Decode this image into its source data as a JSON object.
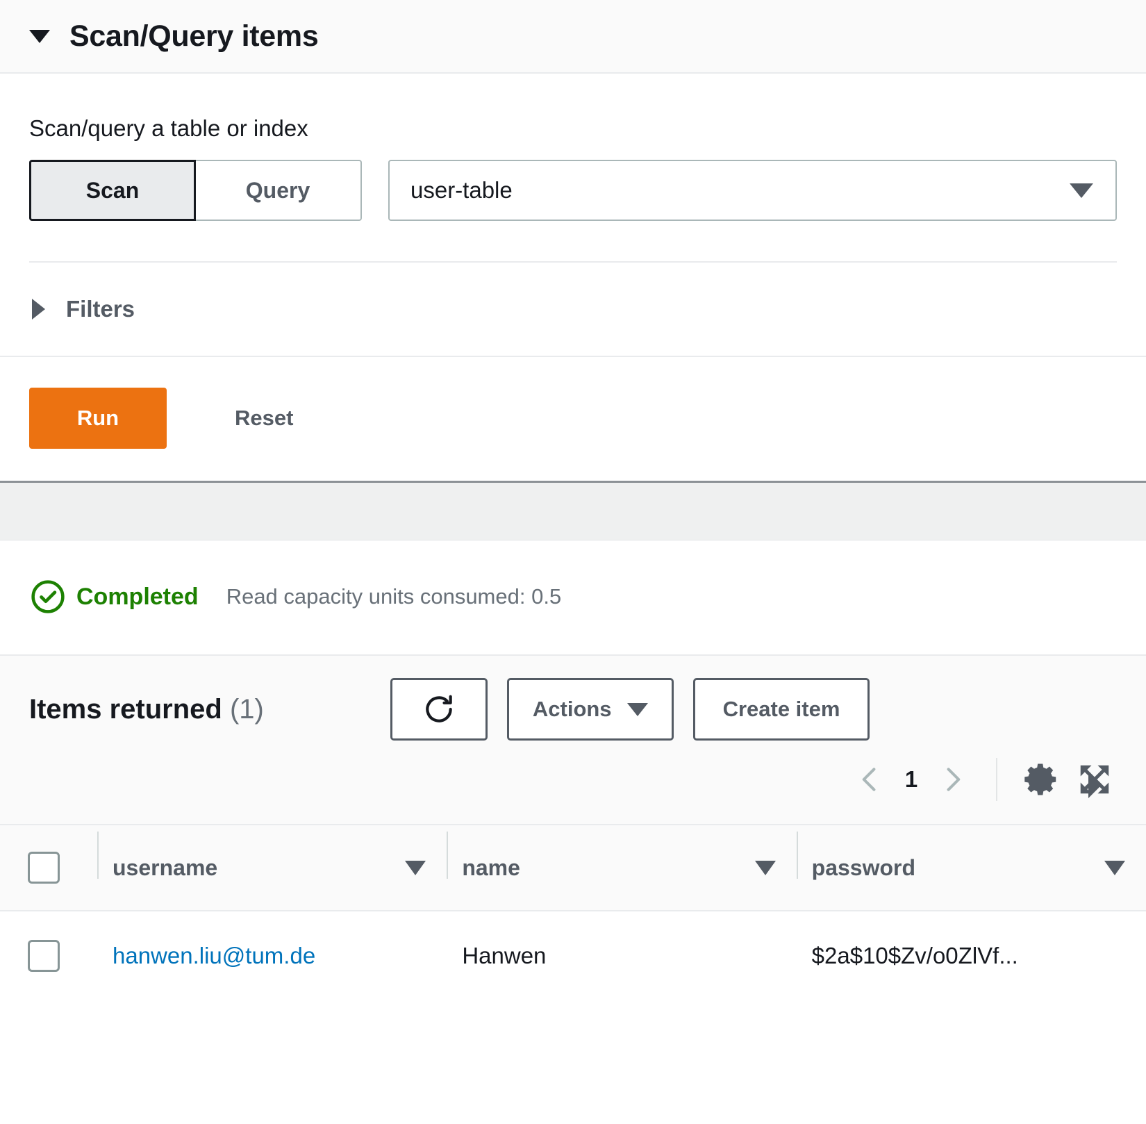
{
  "section": {
    "title": "Scan/Query items",
    "collapse_icon": "caret-down-icon"
  },
  "scan_query": {
    "field_label": "Scan/query a table or index",
    "mode_options": [
      "Scan",
      "Query"
    ],
    "selected_mode": "Scan",
    "scan_label": "Scan",
    "query_label": "Query",
    "table_select_value": "user-table",
    "table_select_options": [
      "user-table"
    ]
  },
  "filters": {
    "label": "Filters",
    "expanded": false
  },
  "buttons": {
    "run": "Run",
    "reset": "Reset",
    "run_color": "#ec7211"
  },
  "status": {
    "state": "Completed",
    "state_color": "#1d8102",
    "detail": "Read capacity units consumed: 0.5"
  },
  "items": {
    "title": "Items returned",
    "count": "(1)",
    "refresh_label": "",
    "actions_label": "Actions",
    "create_item_label": "Create item"
  },
  "pagination": {
    "prev_label": "",
    "page": "1",
    "next_label": "",
    "settings_label": "",
    "fullscreen_label": ""
  },
  "table": {
    "columns": [
      {
        "label": "username"
      },
      {
        "label": "name"
      },
      {
        "label": "password"
      }
    ],
    "rows": [
      {
        "username": "hanwen.liu@tum.de",
        "name": "Hanwen",
        "password": "$2a$10$Zv/o0ZlVf..."
      }
    ]
  }
}
